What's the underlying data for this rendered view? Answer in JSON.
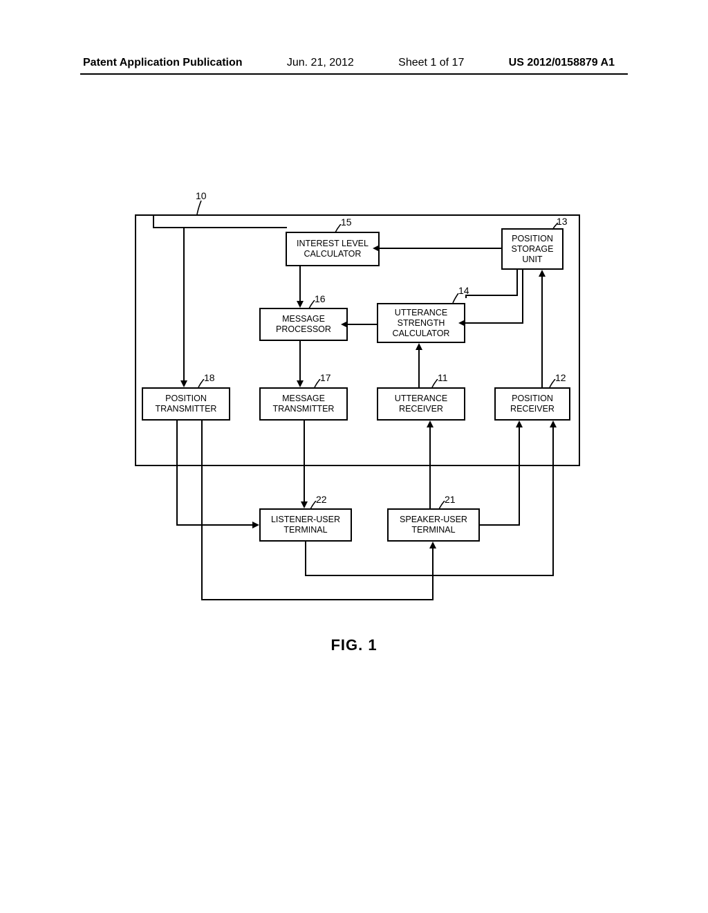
{
  "header": {
    "pub_type": "Patent Application Publication",
    "date": "Jun. 21, 2012",
    "sheet": "Sheet 1 of 17",
    "pub_no": "US 2012/0158879 A1"
  },
  "figure_label": "FIG. 1",
  "refs": {
    "r10": "10",
    "r13": "13",
    "r15": "15",
    "r14": "14",
    "r16": "16",
    "r11": "11",
    "r12": "12",
    "r17": "17",
    "r18": "18",
    "r21": "21",
    "r22": "22"
  },
  "blocks": {
    "interest_level_calculator": "INTEREST LEVEL\nCALCULATOR",
    "position_storage_unit": "POSITION\nSTORAGE\nUNIT",
    "message_processor": "MESSAGE\nPROCESSOR",
    "utterance_strength_calculator": "UTTERANCE\nSTRENGTH\nCALCULATOR",
    "position_transmitter": "POSITION\nTRANSMITTER",
    "message_transmitter": "MESSAGE\nTRANSMITTER",
    "utterance_receiver": "UTTERANCE\nRECEIVER",
    "position_receiver": "POSITION\nRECEIVER",
    "listener_user_terminal": "LISTENER-USER\nTERMINAL",
    "speaker_user_terminal": "SPEAKER-USER\nTERMINAL"
  }
}
